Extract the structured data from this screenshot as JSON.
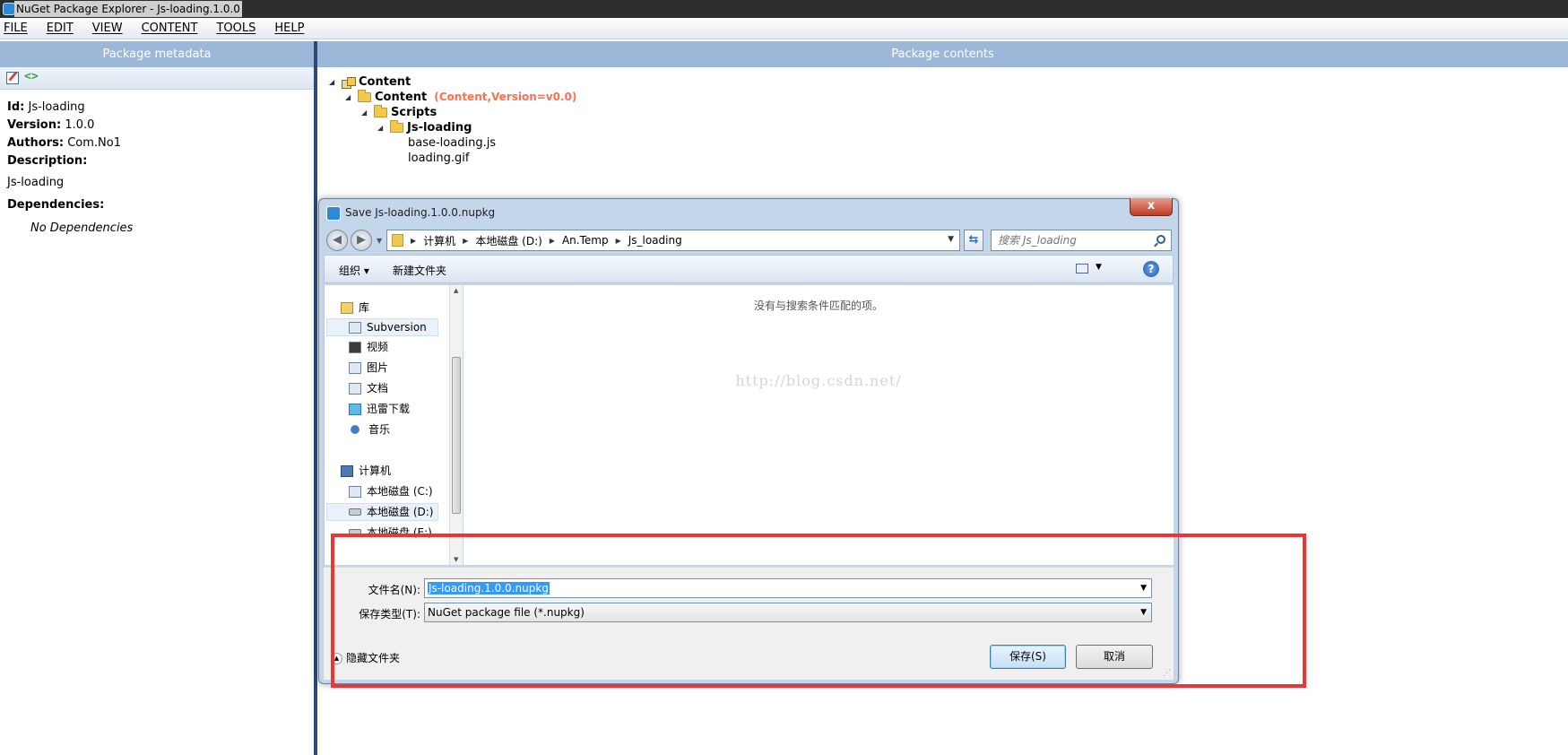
{
  "window": {
    "title": "NuGet Package Explorer - Js-loading.1.0.0"
  },
  "menu": [
    "FILE",
    "EDIT",
    "VIEW",
    "CONTENT",
    "TOOLS",
    "HELP"
  ],
  "left_panel": {
    "header": "Package metadata",
    "id_label": "Id:",
    "id_value": "Js-loading",
    "version_label": "Version:",
    "version_value": "1.0.0",
    "authors_label": "Authors:",
    "authors_value": "Com.No1",
    "description_label": "Description:",
    "description_value": "Js-loading",
    "dependencies_label": "Dependencies:",
    "no_dependencies": "No Dependencies"
  },
  "right_panel": {
    "header": "Package contents",
    "tree": {
      "root": "Content",
      "content_folder": "Content",
      "content_meta": "(Content,Version=v0.0)",
      "scripts_folder": "Scripts",
      "jsloading_folder": "Js-loading",
      "file1": "base-loading.js",
      "file2": "loading.gif"
    }
  },
  "dialog": {
    "title": "Save Js-loading.1.0.0.nupkg",
    "close": "x",
    "breadcrumb": [
      "计算机",
      "本地磁盘 (D:)",
      "An.Temp",
      "Js_loading"
    ],
    "search_placeholder": "搜索 Js_loading",
    "organize": "组织 ▾",
    "new_folder": "新建文件夹",
    "nav": {
      "library": "库",
      "subversion": "Subversion",
      "video": "视频",
      "pictures": "图片",
      "documents": "文档",
      "xunlei": "迅雷下载",
      "music": "音乐",
      "computer": "计算机",
      "drive_c": "本地磁盘 (C:)",
      "drive_d": "本地磁盘 (D:)",
      "drive_e": "本地磁盘 (E:)"
    },
    "empty_message": "没有与搜索条件匹配的项。",
    "watermark": "http://blog.csdn.net/",
    "filename_label": "文件名(N):",
    "filename_value": "Js-loading.1.0.0.nupkg",
    "savetype_label": "保存类型(T):",
    "savetype_value": "NuGet package file (*.nupkg)",
    "hide_folders": "隐藏文件夹",
    "save_button": "保存(S)",
    "cancel_button": "取消"
  },
  "colors": {
    "panel_header": "#9db7d9",
    "meta_highlight": "#ff6f4f",
    "annotation_red": "#ef3434"
  }
}
